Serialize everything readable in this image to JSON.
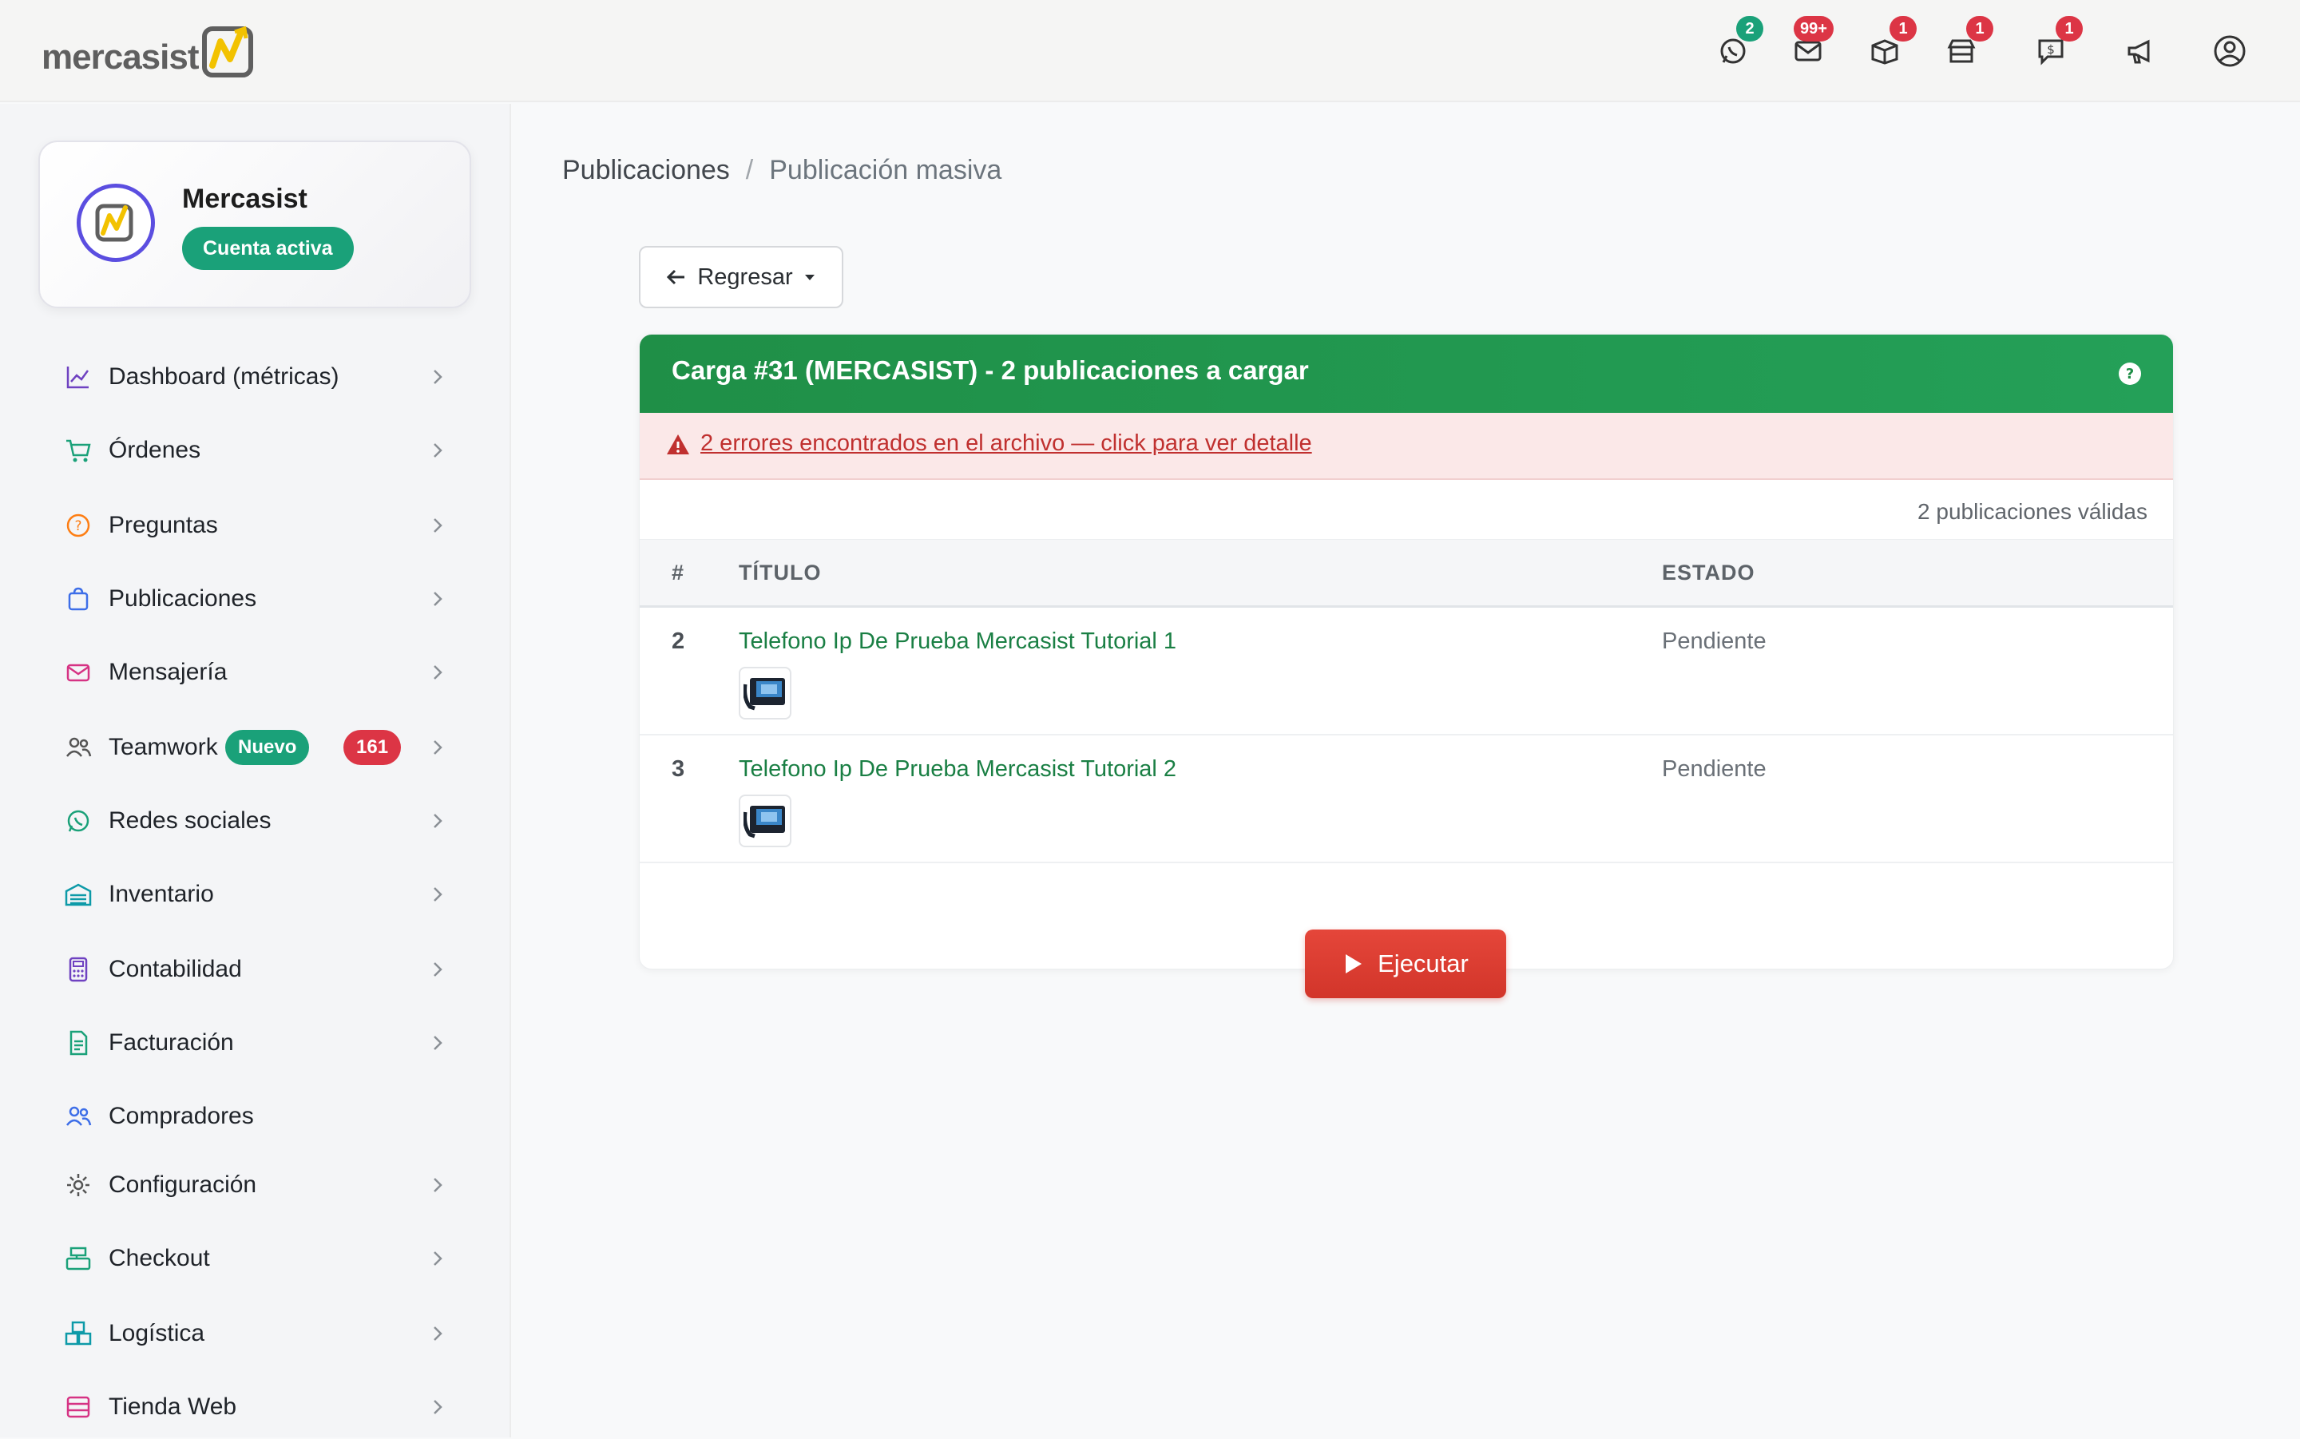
{
  "brand": {
    "name": "mercasist"
  },
  "topbar": {
    "icons": [
      {
        "name": "whatsapp-icon",
        "badge": "2",
        "badge_color": "#1aa179"
      },
      {
        "name": "mail-icon",
        "badge": "99+",
        "badge_color": "#dc3545"
      },
      {
        "name": "box-icon",
        "badge": "1",
        "badge_color": "#dc3545"
      },
      {
        "name": "store-icon",
        "badge": "1",
        "badge_color": "#dc3545"
      },
      {
        "name": "dollar-chat-icon",
        "badge": "1",
        "badge_color": "#dc3545"
      },
      {
        "name": "megaphone-icon"
      },
      {
        "name": "user-circle-icon"
      }
    ]
  },
  "profile": {
    "name": "Mercasist",
    "status": "Cuenta activa"
  },
  "sidebar": {
    "items": [
      {
        "label": "Dashboard (métricas)",
        "icon": "chart-line-icon",
        "color": "#6f42c1"
      },
      {
        "label": "Órdenes",
        "icon": "cart-icon",
        "color": "#1aa179"
      },
      {
        "label": "Preguntas",
        "icon": "question-circle-icon",
        "color": "#fd7e14"
      },
      {
        "label": "Publicaciones",
        "icon": "bag-icon",
        "color": "#3d6ee8"
      },
      {
        "label": "Mensajería",
        "icon": "envelope-icon",
        "color": "#d63384"
      },
      {
        "label": "Teamwork",
        "icon": "people-icon",
        "color": "#555555",
        "tag_new": "Nuevo",
        "count": "161"
      },
      {
        "label": "Redes sociales",
        "icon": "whatsapp-icon",
        "color": "#1aa179"
      },
      {
        "label": "Inventario",
        "icon": "warehouse-icon",
        "color": "#0d9aa8"
      },
      {
        "label": "Contabilidad",
        "icon": "calculator-icon",
        "color": "#6f42c1"
      },
      {
        "label": "Facturación",
        "icon": "file-invoice-icon",
        "color": "#1aa179"
      },
      {
        "label": "Compradores",
        "icon": "users-icon",
        "color": "#3d6ee8"
      },
      {
        "label": "Configuración",
        "icon": "gear-icon",
        "color": "#555555"
      },
      {
        "label": "Checkout",
        "icon": "register-icon",
        "color": "#1aa179"
      },
      {
        "label": "Logística",
        "icon": "boxes-icon",
        "color": "#0d9aa8"
      },
      {
        "label": "Tienda Web",
        "icon": "shop-icon",
        "color": "#d63384"
      }
    ]
  },
  "breadcrumb": {
    "parent": "Publicaciones",
    "separator": "/",
    "current": "Publicación masiva"
  },
  "back_button": {
    "label": "Regresar"
  },
  "card": {
    "title": "Carga #31 (MERCASIST) - 2 publicaciones a cargar",
    "alert": "2 errores encontrados en el archivo — click para ver detalle",
    "valid_count": "2 publicaciones válidas",
    "columns": {
      "num": "#",
      "title": "TÍTULO",
      "status": "ESTADO"
    },
    "rows": [
      {
        "num": "2",
        "title": "Telefono Ip De Prueba Mercasist Tutorial 1",
        "status": "Pendiente"
      },
      {
        "num": "3",
        "title": "Telefono Ip De Prueba Mercasist Tutorial 2",
        "status": "Pendiente"
      }
    ]
  },
  "run_button": {
    "label": "Ejecutar"
  }
}
